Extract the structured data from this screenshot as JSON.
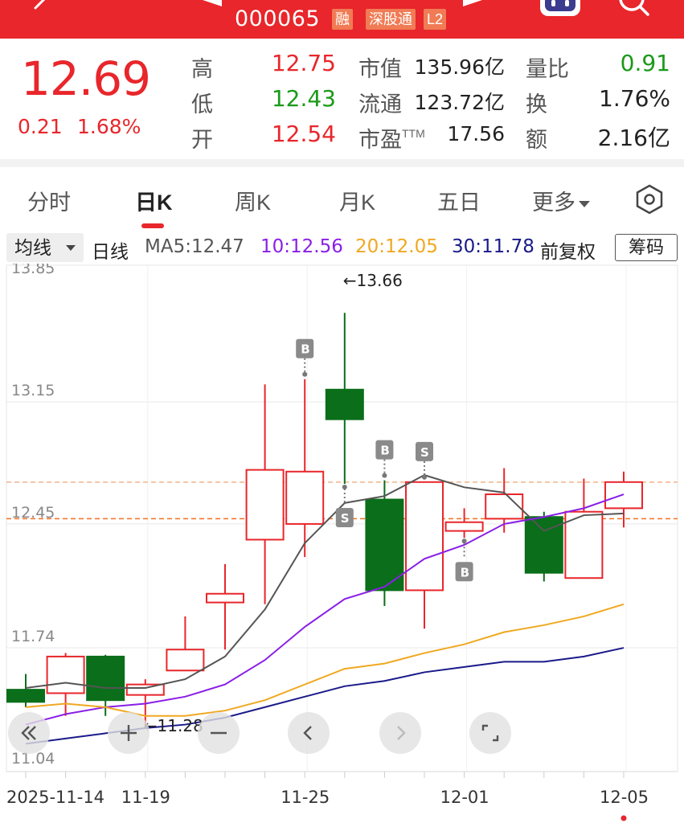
{
  "header": {
    "code": "000065",
    "tags": [
      "融",
      "深股通",
      "L2"
    ],
    "icons": [
      "back-icon",
      "prev-stock-icon",
      "next-stock-icon",
      "assistant-robot-icon",
      "search-icon"
    ]
  },
  "quote": {
    "price": "12.69",
    "change": "0.21",
    "change_pct": "1.68%",
    "stats": [
      {
        "label": "高",
        "value": "12.75",
        "color": "red"
      },
      {
        "label": "低",
        "value": "12.43",
        "color": "green"
      },
      {
        "label": "开",
        "value": "12.54",
        "color": "red"
      },
      {
        "label": "市值",
        "value": "135.96亿",
        "color": "dark"
      },
      {
        "label": "流通",
        "value": "123.72亿",
        "color": "dark"
      },
      {
        "label": "市盈",
        "sup": "TTM",
        "value": "17.56",
        "color": "dark"
      },
      {
        "label": "量比",
        "value": "0.91",
        "color": "green"
      },
      {
        "label": "换",
        "value": "1.76%",
        "color": "dark"
      },
      {
        "label": "额",
        "value": "2.16亿",
        "color": "dark"
      }
    ]
  },
  "tabs": {
    "items": [
      "分时",
      "日K",
      "周K",
      "月K",
      "五日",
      "更多"
    ],
    "active": "日K"
  },
  "ma_row": {
    "selector": "均线",
    "period": "日线",
    "ma5": "MA5:12.47",
    "ma10": "10:12.56",
    "ma20": "20:12.05",
    "ma30": "30:11.78",
    "adjust": "前复权",
    "chips_button": "筹码"
  },
  "colors": {
    "up": "#e8262b",
    "down": "#0a6e1a",
    "ma5": "#555555",
    "ma10": "#8a1ee6",
    "ma20": "#f0a820",
    "ma30": "#1a1a8a",
    "header_bg": "#e8262b"
  },
  "chart_data": {
    "type": "candlestick",
    "y_ticks": [
      "13.85",
      "13.15",
      "12.45",
      "11.74",
      "11.04"
    ],
    "ylim": [
      11.04,
      13.85
    ],
    "x_labels": [
      {
        "text": "2025-11-14",
        "index": 0
      },
      {
        "text": "11-19",
        "index": 3
      },
      {
        "text": "11-25",
        "index": 7
      },
      {
        "text": "12-01",
        "index": 11
      },
      {
        "text": "12-05",
        "index": 15
      }
    ],
    "candles": [
      {
        "open": 11.5,
        "close": 11.43,
        "high": 11.59,
        "low": 11.4
      },
      {
        "open": 11.48,
        "close": 11.69,
        "high": 11.71,
        "low": 11.35
      },
      {
        "open": 11.69,
        "close": 11.44,
        "high": 11.7,
        "low": 11.35
      },
      {
        "open": 11.47,
        "close": 11.53,
        "high": 11.56,
        "low": 11.28
      },
      {
        "open": 11.61,
        "close": 11.73,
        "high": 11.92,
        "low": 11.61
      },
      {
        "open": 12.0,
        "close": 12.05,
        "high": 12.22,
        "low": 11.73
      },
      {
        "open": 12.36,
        "close": 12.76,
        "high": 13.25,
        "low": 11.99
      },
      {
        "open": 12.45,
        "close": 12.75,
        "high": 13.28,
        "low": 12.26
      },
      {
        "open": 13.22,
        "close": 13.05,
        "high": 13.66,
        "low": 12.68
      },
      {
        "open": 12.59,
        "close": 12.07,
        "high": 12.7,
        "low": 11.98
      },
      {
        "open": 12.07,
        "close": 12.69,
        "high": 12.69,
        "low": 11.85
      },
      {
        "open": 12.41,
        "close": 12.46,
        "high": 12.54,
        "low": 12.37
      },
      {
        "open": 12.48,
        "close": 12.62,
        "high": 12.77,
        "low": 12.4
      },
      {
        "open": 12.49,
        "close": 12.17,
        "high": 12.52,
        "low": 12.12
      },
      {
        "open": 12.14,
        "close": 12.52,
        "high": 12.71,
        "low": 12.14
      },
      {
        "open": 12.54,
        "close": 12.69,
        "high": 12.75,
        "low": 12.43
      }
    ],
    "series": [
      {
        "name": "MA5",
        "values": [
          11.51,
          11.54,
          11.51,
          11.51,
          11.56,
          11.69,
          11.96,
          12.34,
          12.57,
          12.61,
          12.73,
          12.66,
          12.63,
          12.41,
          12.5,
          12.51
        ]
      },
      {
        "name": "10",
        "values": [
          11.3,
          11.36,
          11.4,
          11.42,
          11.46,
          11.53,
          11.67,
          11.86,
          12.02,
          12.09,
          12.25,
          12.33,
          12.45,
          12.49,
          12.54,
          12.62
        ]
      },
      {
        "name": "20",
        "values": [
          11.4,
          11.42,
          11.4,
          11.35,
          11.35,
          11.38,
          11.44,
          11.53,
          11.62,
          11.65,
          11.71,
          11.76,
          11.83,
          11.87,
          11.92,
          11.99
        ]
      },
      {
        "name": "30",
        "values": [
          11.19,
          11.22,
          11.25,
          11.28,
          11.3,
          11.34,
          11.4,
          11.46,
          11.52,
          11.55,
          11.6,
          11.63,
          11.66,
          11.66,
          11.69,
          11.74
        ]
      }
    ],
    "ref_lines": [
      {
        "value": 12.69,
        "style": "dashed"
      },
      {
        "value": 12.48,
        "style": "dashed"
      }
    ],
    "annotations": [
      {
        "text": "←13.66",
        "index": 8,
        "value": 13.66
      },
      {
        "text": "←11.28",
        "index": 3,
        "value": 11.28
      }
    ],
    "signals": [
      {
        "text": "B",
        "index": 7,
        "position": "above"
      },
      {
        "text": "S",
        "index": 8,
        "position": "below"
      },
      {
        "text": "B",
        "index": 9,
        "position": "above"
      },
      {
        "text": "S",
        "index": 10,
        "position": "above"
      },
      {
        "text": "B",
        "index": 11,
        "position": "below"
      }
    ]
  },
  "chart_controls": [
    "collapse-left-icon",
    "zoom-in-icon",
    "zoom-out-icon",
    "previous-icon",
    "next-icon",
    "fullscreen-icon"
  ]
}
